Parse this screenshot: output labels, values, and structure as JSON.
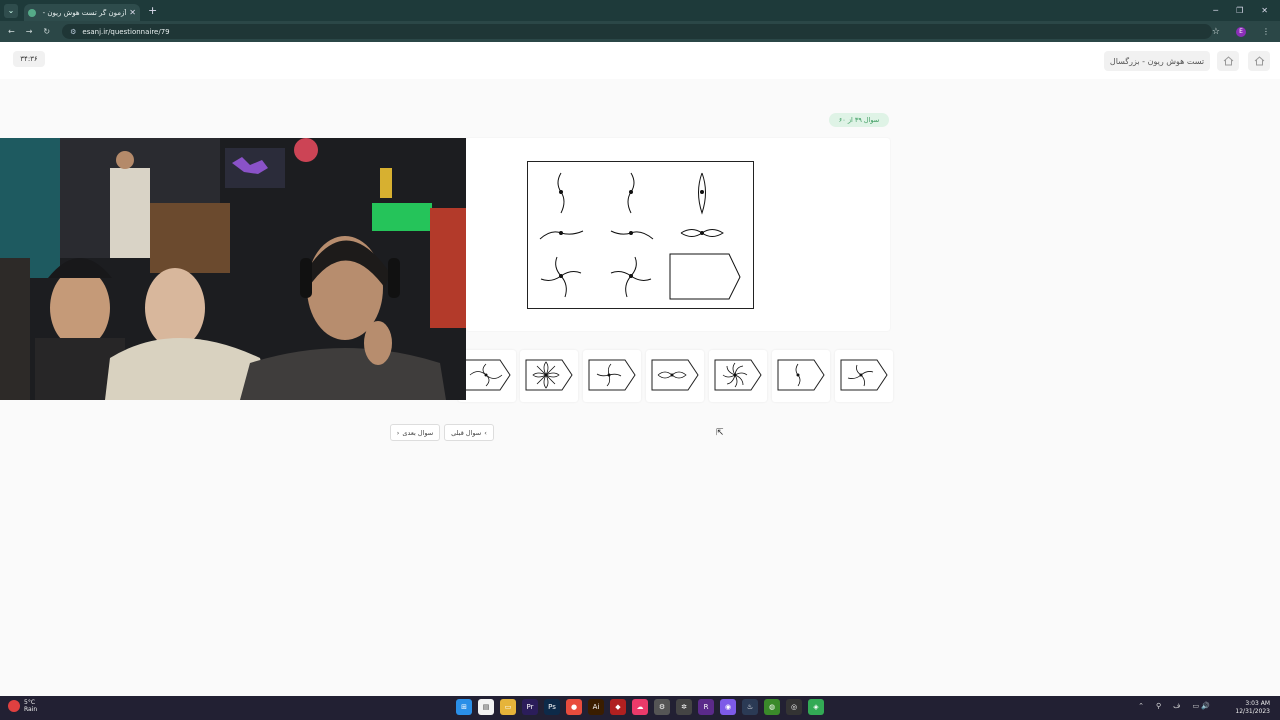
{
  "browser": {
    "tab_title": "آزمون گر تست هوش ریون - بزرگ",
    "url": "esanj.ir/questionnaire/79",
    "profile_initial": "E"
  },
  "header": {
    "timer": "۳۴:۳۶",
    "breadcrumb": "تست هوش ریون - بزرگسال"
  },
  "question": {
    "counter": "سوال ۳۹ از ۶۰"
  },
  "options_count_icons": [
    "opt-1",
    "opt-2",
    "opt-3",
    "opt-4",
    "opt-5",
    "opt-6",
    "opt-7"
  ],
  "navigation": {
    "next_label": "سوال بعدی",
    "prev_label": "سوال قبلی"
  },
  "taskbar": {
    "weather_temp": "5°C",
    "weather_desc": "Rain",
    "time": "3:03 AM",
    "date": "12/31/2023"
  }
}
